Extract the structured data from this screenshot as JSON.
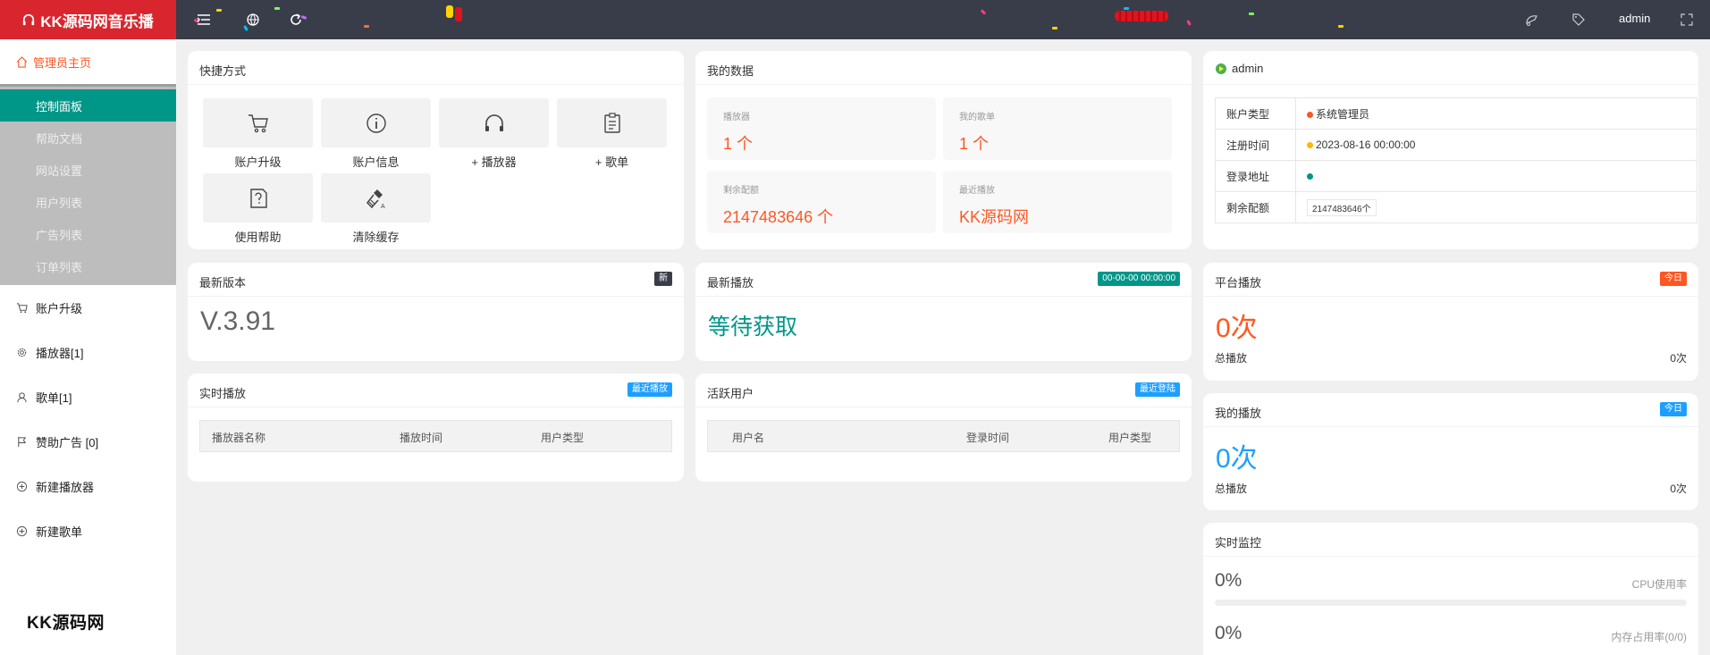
{
  "sidebar": {
    "logo": "KK源码网音乐播",
    "main": "管理员主页",
    "sub": [
      "控制面板",
      "帮助文档",
      "网站设置",
      "用户列表",
      "广告列表",
      "订单列表"
    ],
    "items": [
      "账户升级",
      "播放器[1]",
      "歌单[1]",
      "赞助广告 [0]",
      "新建播放器",
      "新建歌单"
    ],
    "brand": "KK源码网"
  },
  "header": {
    "user": "admin"
  },
  "shortcuts": {
    "title": "快捷方式",
    "buttons": [
      {
        "label": "账户升级",
        "icon": "cart-icon"
      },
      {
        "label": "账户信息",
        "icon": "info-icon"
      },
      {
        "label": "+ 播放器",
        "icon": "headphone-icon"
      },
      {
        "label": "+ 歌单",
        "icon": "list-icon"
      },
      {
        "label": "使用帮助",
        "icon": "help-icon"
      },
      {
        "label": "清除缓存",
        "icon": "brush-icon"
      }
    ]
  },
  "mydata": {
    "title": "我的数据",
    "stats": [
      {
        "label": "播放器",
        "value": "1 个"
      },
      {
        "label": "我的歌单",
        "value": "1 个"
      },
      {
        "label": "剩余配额",
        "value": "2147483646 个"
      },
      {
        "label": "最近播放",
        "value": "KK源码网"
      }
    ]
  },
  "account": {
    "name": "admin",
    "rows": [
      {
        "key": "账户类型",
        "value": "系统管理员",
        "dot": "#ff5722"
      },
      {
        "key": "注册时间",
        "value": "2023-08-16 00:00:00",
        "dot": "#ffb800"
      },
      {
        "key": "登录地址",
        "value": "",
        "dot": "#009688"
      },
      {
        "key": "剩余配额",
        "value": "2147483646个"
      }
    ]
  },
  "version": {
    "title": "最新版本",
    "badge": "新",
    "value": "V.3.91"
  },
  "latest": {
    "title": "最新播放",
    "badge": "00-00-00 00:00:00",
    "value": "等待获取"
  },
  "platform": {
    "title": "平台播放",
    "badge": "今日",
    "value": "0次",
    "total_label": "总播放",
    "total_value": "0次"
  },
  "myplay": {
    "title": "我的播放",
    "badge": "今日",
    "value": "0次",
    "total_label": "总播放",
    "total_value": "0次"
  },
  "realtime": {
    "title": "实时播放",
    "badge": "最近播放",
    "cols": [
      "播放器名称",
      "播放时间",
      "用户类型"
    ]
  },
  "active": {
    "title": "活跃用户",
    "badge": "最近登陆",
    "cols": [
      "用户名",
      "登录时间",
      "用户类型"
    ]
  },
  "monitor": {
    "title": "实时监控",
    "cpu": {
      "value": "0%",
      "label": "CPU使用率",
      "fraction": 0
    },
    "mem": {
      "value": "0%",
      "label": "内存占用率(0/0)",
      "fraction": 0
    }
  },
  "colors": {
    "accent": "#009688",
    "logo_bg": "#d9262e",
    "orange": "#ff5722",
    "blue": "#1e9fff",
    "header_bg": "#393d49"
  }
}
